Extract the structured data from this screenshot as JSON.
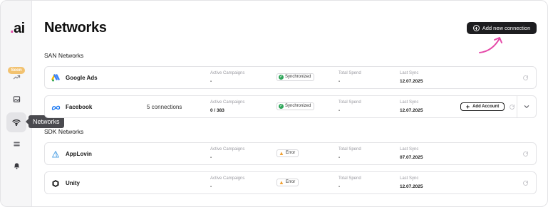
{
  "app": {
    "logo_text": ".ai",
    "page_title": "Networks",
    "add_connection_label": "Add new connection"
  },
  "sidebar": {
    "soon_badge": "Soon",
    "tooltip": "Networks",
    "items": [
      {
        "icon": "trending-up-icon"
      },
      {
        "icon": "image-icon"
      },
      {
        "icon": "wifi-icon",
        "active": true
      },
      {
        "icon": "menu-icon"
      },
      {
        "icon": "bell-icon"
      }
    ]
  },
  "sections": {
    "san_title": "SAN Networks",
    "sdk_title": "SDK Networks"
  },
  "networks": {
    "google": {
      "name": "Google Ads",
      "active_campaigns_label": "Active Campaigns",
      "active_campaigns": "-",
      "status": "Synchronized",
      "total_spend_label": "Total Spend",
      "total_spend": "-",
      "last_sync_label": "Last Sync",
      "last_sync": "12.07.2025"
    },
    "facebook": {
      "name": "Facebook",
      "connections": "5 connections",
      "active_campaigns_label": "Active Campaigns",
      "active_campaigns": "0 / 383",
      "status": "Synchronized",
      "total_spend_label": "Total Spend",
      "total_spend": "-",
      "last_sync_label": "Last Sync",
      "last_sync": "12.07.2025",
      "add_account_label": "Add Account"
    },
    "applovin": {
      "name": "AppLovin",
      "active_campaigns_label": "Active Campaigns",
      "active_campaigns": "-",
      "status": "Error",
      "total_spend_label": "Total Spend",
      "total_spend": "-",
      "last_sync_label": "Last Sync",
      "last_sync": "07.07.2025"
    },
    "unity": {
      "name": "Unity",
      "active_campaigns_label": "Active Campaigns",
      "active_campaigns": "-",
      "status": "Error",
      "total_spend_label": "Total Spend",
      "total_spend": "-",
      "last_sync_label": "Last Sync",
      "last_sync": "12.07.2025"
    }
  },
  "colors": {
    "accent_pink": "#e54aa9",
    "synced_green": "#2fa65a",
    "error_orange": "#f0a136",
    "primary_dark": "#1d1d20",
    "soon_badge": "#f2c270"
  }
}
